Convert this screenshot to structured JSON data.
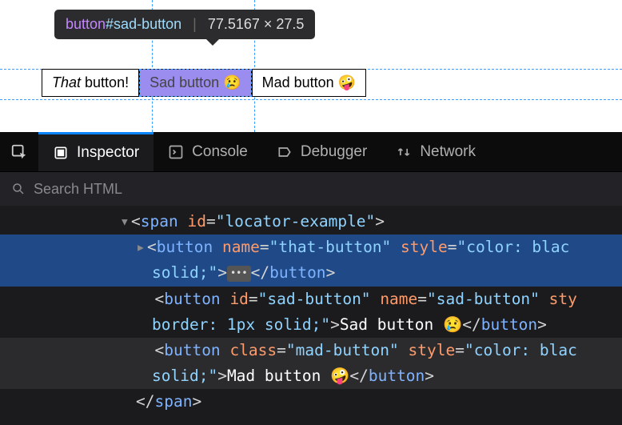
{
  "tooltip": {
    "tag": "button",
    "id": "#sad-button",
    "dimensions": "77.5167 × 27.5"
  },
  "buttons": {
    "that": {
      "prefix": "That",
      "suffix": " button!"
    },
    "sad": "Sad button 😢",
    "mad": "Mad button 🤪"
  },
  "devtools": {
    "tabs": {
      "inspector": "Inspector",
      "console": "Console",
      "debugger": "Debugger",
      "network": "Network"
    },
    "search_placeholder": "Search HTML"
  },
  "dom": {
    "open_span": {
      "bracket_open": "<",
      "tag": "span",
      "attr_id": "id",
      "val_id": "\"locator-example\"",
      "bracket_close": ">"
    },
    "btn1_a": {
      "bracket_open": "<",
      "tag": "button",
      "attr_name": "name",
      "val_name": "\"that-button\"",
      "attr_style": "style",
      "val_style": "\"color: blac"
    },
    "btn1_b": {
      "val_cont": "solid;\"",
      "bracket": ">",
      "close": "</",
      "tag": "button",
      "end": ">"
    },
    "btn2_a": {
      "bracket_open": "<",
      "tag": "button",
      "attr_id": "id",
      "val_id": "\"sad-button\"",
      "attr_name": "name",
      "val_name": "\"sad-button\"",
      "attr_sty": "sty"
    },
    "btn2_b": {
      "val_cont": "border: 1px solid;\"",
      "bracket": ">",
      "text": "Sad button 😢",
      "close": "</",
      "tag": "button",
      "end": ">"
    },
    "btn3_a": {
      "bracket_open": "<",
      "tag": "button",
      "attr_class": "class",
      "val_class": "\"mad-button\"",
      "attr_style": "style",
      "val_style": "\"color: blac"
    },
    "btn3_b": {
      "val_cont": "solid;\"",
      "bracket": ">",
      "text": "Mad button 🤪",
      "close": "</",
      "tag": "button",
      "end": ">"
    },
    "close_span": {
      "close": "</",
      "tag": "span",
      "end": ">"
    }
  }
}
